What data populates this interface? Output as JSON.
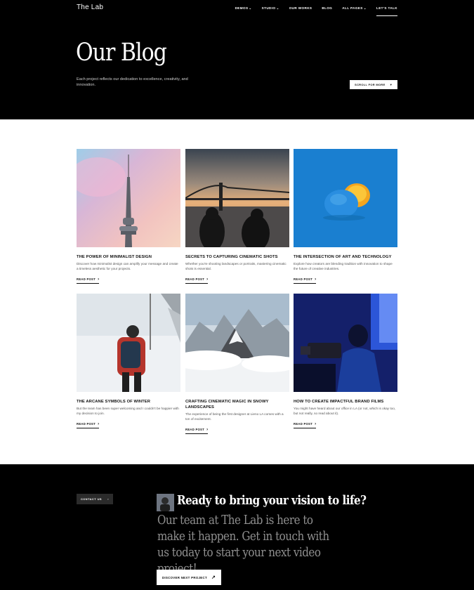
{
  "header": {
    "logo": "The Lab",
    "nav": [
      {
        "label": "DEMOS",
        "has_dropdown": true
      },
      {
        "label": "STUDIO",
        "has_dropdown": true
      },
      {
        "label": "OUR WORKS",
        "has_dropdown": false
      },
      {
        "label": "BLOG",
        "has_dropdown": false
      },
      {
        "label": "ALL PAGES",
        "has_dropdown": true
      },
      {
        "label": "LET'S TALK",
        "has_dropdown": false
      }
    ]
  },
  "hero": {
    "title": "Our Blog",
    "subtitle": "Each project reflects our dedication to excellence, creativity, and innovation.",
    "scroll_label": "SCROLL FOR MORE",
    "scroll_icon": "arrow-down-icon"
  },
  "posts": [
    {
      "title": "THE POWER OF MINIMALIST DESIGN",
      "desc": "Discover how minimalist design can amplify your message and create a timeless aesthetic for your projects.",
      "link": "READ POST",
      "image": "tv-tower-pastel-sky"
    },
    {
      "title": "SECRETS TO CAPTURING CINEMATIC SHOTS",
      "desc": "Whether you're shooting landscapes or portraits, mastering cinematic shots is essential.",
      "link": "READ POST",
      "image": "bridge-sunset-silhouettes"
    },
    {
      "title": "THE INTERSECTION OF ART AND TECHNOLOGY",
      "desc": "Explore how creators are blending tradition with innovation to shape the future of creative industries.",
      "link": "READ POST",
      "image": "blue-painted-orange"
    },
    {
      "title": "THE ARCANE SYMBOLS OF WINTER",
      "desc": "But the team has been super welcoming and I couldn't be happier with my decision to join.",
      "link": "READ POST",
      "image": "hiker-snow"
    },
    {
      "title": "CRAFTING CINEMATIC MAGIC IN SNOWY LANDSCAPES",
      "desc": "The experience of being the first designer at Lieno LA comes with a ton of excitement.",
      "link": "READ POST",
      "image": "snowy-mountain-peaks"
    },
    {
      "title": "HOW TO CREATE IMPACTFUL BRAND FILMS",
      "desc": "You might have heard about our office in LA (or not, which is okay too, but not really, so read about it).",
      "link": "READ POST",
      "image": "camera-operator-blue-light"
    }
  ],
  "cta": {
    "contact_label": "CONTACT US",
    "headline": "Ready to bring your vision to life?",
    "body": "Our team at The Lab is here to make it happen. Get in touch with us today to start your next video project!",
    "discover_label": "DISCOVER NEXT PROJECT",
    "colors": {
      "headline": "#ffffff",
      "body": "#8f8f8f"
    }
  }
}
